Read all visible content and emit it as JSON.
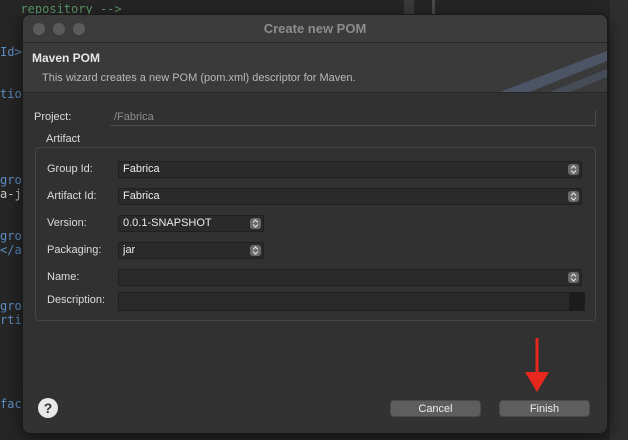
{
  "background_editor": {
    "lines": [
      {
        "text": "  repository -->",
        "kind": "comment"
      },
      {
        "text": "Id>",
        "kind": "tag"
      },
      {
        "text": "tio",
        "kind": "tag"
      },
      {
        "text": "gro",
        "kind": "tag"
      },
      {
        "text": "a-j",
        "kind": "text"
      },
      {
        "text": "gro",
        "kind": "tag"
      },
      {
        "text": "</a",
        "kind": "tag"
      },
      {
        "text": "gro",
        "kind": "tag"
      },
      {
        "text": "rti",
        "kind": "tag"
      },
      {
        "text": "fac",
        "kind": "tag"
      }
    ]
  },
  "dialog": {
    "title": "Create new POM",
    "header": {
      "title": "Maven POM",
      "description": "This wizard creates a new POM (pom.xml) descriptor for Maven."
    },
    "project": {
      "label": "Project:",
      "value": "/Fabrica"
    },
    "artifact_group": {
      "legend": "Artifact",
      "fields": {
        "group_id": {
          "label": "Group Id:",
          "value": "Fabrica"
        },
        "artifact_id": {
          "label": "Artifact Id:",
          "value": "Fabrica"
        },
        "version": {
          "label": "Version:",
          "value": "0.0.1-SNAPSHOT"
        },
        "packaging": {
          "label": "Packaging:",
          "value": "jar"
        },
        "name": {
          "label": "Name:",
          "value": ""
        },
        "description": {
          "label": "Description:",
          "value": ""
        }
      }
    },
    "footer": {
      "help_icon": "?",
      "cancel_label": "Cancel",
      "finish_label": "Finish"
    }
  },
  "colors": {
    "annotation_arrow": "#e8281e"
  },
  "icons": {
    "help": "question-mark-icon",
    "dropdown": "chevron-updown-icon",
    "annotation": "red-down-arrow-icon"
  }
}
